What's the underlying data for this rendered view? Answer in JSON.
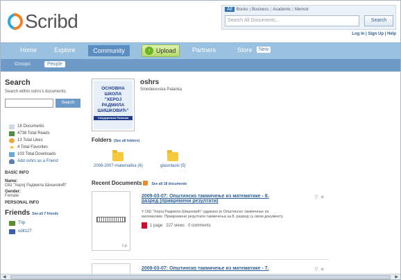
{
  "header": {
    "logo_text": "Scribd",
    "search": {
      "tabs": [
        "All",
        "Books",
        "Business",
        "Academic",
        "Memoir"
      ],
      "placeholder": "Search All Documents...",
      "button": "Search"
    },
    "top_links": "Log In | Sign Up | Help"
  },
  "nav": {
    "home": "Home",
    "explore": "Explore",
    "community": "Community",
    "upload": "Upload",
    "partners": "Partners",
    "store": "Store",
    "new_badge": "New"
  },
  "subnav": {
    "groups": "Groups",
    "people": "People"
  },
  "sidebar": {
    "title": "Search",
    "note": "Search within oshrs's documents:",
    "search_button": "Search",
    "stats": [
      {
        "icon": "document-icon",
        "label": "18 Documents",
        "color": "#cfd8e3"
      },
      {
        "icon": "reads-icon",
        "label": "4738 Total Reads",
        "color": "#4f8f3f"
      },
      {
        "icon": "likes-icon",
        "label": "13 Total Likes",
        "color": "#f2a43a"
      },
      {
        "icon": "star-icon",
        "label": "4 Total Favorites",
        "color": "#f5c23a"
      },
      {
        "icon": "download-icon",
        "label": "103 Total Downloads",
        "color": "#6aa7dc"
      },
      {
        "icon": "add-friend-icon",
        "label": "Add oshrs as a Friend",
        "color": "#5a7fb0"
      }
    ],
    "basic_info": "BASIC INFO",
    "name_label": "Name:",
    "name_value": "ОШ \"Херој Радмила Шишковић\"",
    "gender_label": "Gender:",
    "gender_value": "Female",
    "personal_info": "PERSONAL INFO",
    "friends_title": "Friends",
    "friends_see_all": "See all 7 friends",
    "friends": [
      {
        "name": "Trip",
        "icon": "friend-avatar-icon",
        "color": "#5b8f2e"
      },
      {
        "name": "odit127",
        "icon": "friend-avatar-icon",
        "color": "#3a5fa8"
      }
    ]
  },
  "profile": {
    "image_text_lines": [
      "ОСНОВНА",
      "ШКОЛА",
      "\"ХЕРОЈ",
      "РАДМИЛА",
      "ШИШКОВИЋ\""
    ],
    "image_caption": "Смедеревска Паланка",
    "username": "oshrs",
    "location": "Smederevska Palanka"
  },
  "folders": {
    "title": "Folders",
    "see_all": "(See all folders)",
    "items": [
      {
        "label": "2008-2007-matematika (6)"
      },
      {
        "label": "glasnilacki (5)"
      }
    ]
  },
  "recent": {
    "title": "Recent Documents",
    "see_all": "See all 18 documents",
    "docs": [
      {
        "title_line1": "2009-03-07: Општинско такмичење из математике - 8.",
        "title_line2": "разред (привремени резултати)",
        "desc_line1": "У ОШ \"Херој Радмила Шишковић\" одржано је Општинско такмичење из",
        "desc_line2": "математике. Привремени резултати такмичења за 8. разред су овом документу.",
        "meta_pages": "1 page",
        "meta_views": "227 views",
        "meta_comments": "0 comments",
        "thumb_page": "1 p."
      },
      {
        "title_line1": "2009-03-07: Општинско такмичење из математике - 7."
      }
    ]
  }
}
